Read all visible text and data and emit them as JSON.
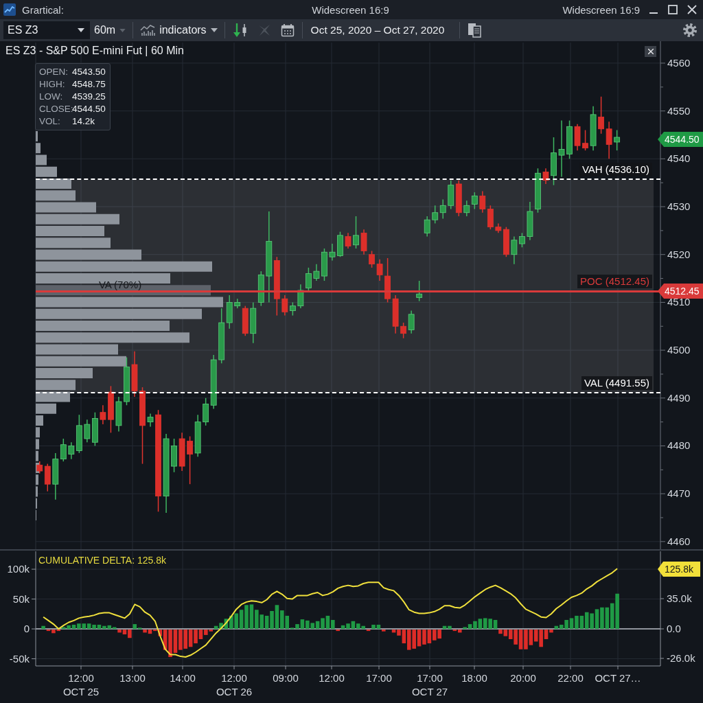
{
  "window": {
    "title": "Grartical:",
    "center_label": "Widescreen 16:9",
    "right_label": "Widescreen 16:9"
  },
  "toolbar": {
    "symbol": "ES Z3",
    "interval": "60m",
    "indicators": "indicators",
    "date_range": "Oct 25, 2020 – Oct 27, 2020"
  },
  "chart": {
    "title": "ES Z3 - S&P 500 E-mini Fut | 60 Min",
    "ohlc": [
      {
        "label": "OPEN:",
        "value": "4543.50"
      },
      {
        "label": "HIGH:",
        "value": "4548.75"
      },
      {
        "label": "LOW:",
        "value": "4539.25"
      },
      {
        "label": "CLOSE:",
        "value": "4544.50"
      },
      {
        "label": "VOL:",
        "value": "14.2k"
      }
    ],
    "value_area_label": "VA (70%)",
    "levels": [
      {
        "kind": "dashed",
        "label": "VAH (4536.10)",
        "color": "#ffffff"
      },
      {
        "kind": "solid",
        "label": "POC (4512.45)",
        "color": "#d93a3a"
      },
      {
        "kind": "dashed",
        "label": "VAL (4491.55)",
        "color": "#ffffff"
      }
    ],
    "price_markers": [
      {
        "value": "4544.50",
        "color": "#1f9a45"
      },
      {
        "value": "4512.45",
        "color": "#d93a3a"
      }
    ],
    "chart_data": {
      "type": "candlestick",
      "categories": [
        null,
        null,
        null,
        null,
        null,
        null,
        null,
        null,
        null,
        null,
        null,
        null,
        null,
        null,
        null,
        null,
        null,
        null,
        null,
        null,
        null,
        null,
        null,
        null,
        null,
        null,
        null,
        null,
        null,
        null,
        null,
        null,
        null,
        null,
        null,
        null,
        null,
        null,
        null,
        null,
        null,
        null,
        null,
        null,
        null,
        null,
        null,
        null,
        null,
        null,
        null,
        null,
        null,
        null,
        null,
        null,
        null,
        null,
        null,
        null,
        null,
        null,
        null,
        null,
        null,
        null,
        null,
        null,
        null,
        null,
        null,
        null,
        null,
        null,
        null,
        null,
        null,
        null,
        null
      ],
      "ylim": [
        4458.4,
        4564.3
      ],
      "yticks": [
        4560,
        4550,
        4540,
        4530,
        4520,
        4510,
        4500,
        4490,
        4480,
        4470,
        4460
      ],
      "grid": true,
      "ohlc": [
        [
          4476,
          4476.75,
          4474.25,
          4474.75
        ],
        [
          4475.75,
          4476.25,
          4470.5,
          4472
        ],
        [
          4472,
          4478.5,
          4468.75,
          4477.25
        ],
        [
          4477.25,
          4481.5,
          4476.75,
          4480.25
        ],
        [
          4478.25,
          4480.75,
          4477.25,
          4480
        ],
        [
          4479,
          4486.5,
          4478.5,
          4484.25
        ],
        [
          4481.5,
          4485.5,
          4480.75,
          4484.5
        ],
        [
          4480.75,
          4487,
          4480,
          4485.75
        ],
        [
          4487,
          4488.5,
          4484.5,
          4485.5
        ],
        [
          4491.25,
          4492.5,
          4482.75,
          4485.5
        ],
        [
          4484.25,
          4490.25,
          4483,
          4489.25
        ],
        [
          4489.25,
          4498.5,
          4488.5,
          4496.5
        ],
        [
          4497,
          4499.75,
          4490.25,
          4491.5
        ],
        [
          4491.5,
          4492.25,
          4476.25,
          4484.25
        ],
        [
          4485,
          4486.75,
          4484,
          4486
        ],
        [
          4486.5,
          4487.5,
          4466.25,
          4469.5
        ],
        [
          4469.5,
          4482.5,
          4466,
          4481.5
        ],
        [
          4475.75,
          4481.5,
          4474.5,
          4480
        ],
        [
          4481.5,
          4482.75,
          4474.75,
          4475.75
        ],
        [
          4481,
          4482,
          4472,
          4478.25
        ],
        [
          4478.5,
          4486.5,
          4477.75,
          4485
        ],
        [
          4485,
          4490,
          4484.25,
          4488.75
        ],
        [
          4488.5,
          4499,
          4487.75,
          4498
        ],
        [
          4498,
          4508.75,
          4497.25,
          4505.75
        ],
        [
          4505.75,
          4511.5,
          4504.5,
          4510
        ],
        [
          4509.25,
          4510.75,
          4508.75,
          4510
        ],
        [
          4508.75,
          4509.25,
          4503,
          4503.5
        ],
        [
          4503.5,
          4510,
          4501.5,
          4508.75
        ],
        [
          4510,
          4516.5,
          4509.25,
          4515.75
        ],
        [
          4515.5,
          4529,
          4510,
          4522.75
        ],
        [
          4518.75,
          4519.5,
          4507.25,
          4510.75
        ],
        [
          4510.75,
          4511.5,
          4507.25,
          4508
        ],
        [
          4508.25,
          4510,
          4507.25,
          4509.25
        ],
        [
          4509.25,
          4513.75,
          4508.75,
          4512.5
        ],
        [
          4513,
          4517.25,
          4512.25,
          4516
        ],
        [
          4515,
          4518,
          4514.5,
          4516.5
        ],
        [
          4515.5,
          4521.25,
          4514.5,
          4520.5
        ],
        [
          4519.5,
          4522.25,
          4518.75,
          4520.5
        ],
        [
          4519.75,
          4524.75,
          4519.5,
          4524
        ],
        [
          4523.75,
          4524.5,
          4521.25,
          4521.75
        ],
        [
          4522,
          4528,
          4521.25,
          4524
        ],
        [
          4524.5,
          4525.25,
          4520,
          4520.75
        ],
        [
          4520,
          4520.75,
          4517.25,
          4518
        ],
        [
          4518,
          4519,
          4514.5,
          4515.75
        ],
        [
          4515.5,
          4519.25,
          4510,
          4510.75
        ],
        [
          4510.75,
          4511.5,
          4503.5,
          4505
        ],
        [
          4505,
          4505.75,
          4502.5,
          4503.5
        ],
        [
          4504.25,
          4508.25,
          4503.5,
          4507.5
        ],
        [
          4511,
          4514.5,
          4510.25,
          4511.75
        ],
        [
          4524.5,
          4528,
          4523.75,
          4527.25
        ],
        [
          4527.25,
          4530.25,
          4526.5,
          4528.75
        ],
        [
          4528.75,
          4531.5,
          4527.5,
          4530.25
        ],
        [
          4530.25,
          4535.5,
          4529.5,
          4534.5
        ],
        [
          4534.75,
          4535.5,
          4528,
          4528.75
        ],
        [
          4528.75,
          4531.25,
          4528,
          4530.25
        ],
        [
          4530.5,
          4533,
          4529.5,
          4532.25
        ],
        [
          4532.25,
          4533.25,
          4528.75,
          4529.5
        ],
        [
          4529.5,
          4530.25,
          4525.25,
          4525.75
        ],
        [
          4525.75,
          4526.5,
          4524.5,
          4525
        ],
        [
          4525.25,
          4525.75,
          4519.5,
          4520
        ],
        [
          4520,
          4523.75,
          4518,
          4523
        ],
        [
          4522.25,
          4524.5,
          4521.5,
          4523.75
        ],
        [
          4523.75,
          4531,
          4523,
          4529
        ],
        [
          4529.5,
          4538,
          4528.75,
          4537
        ],
        [
          4537.25,
          4538,
          4534.75,
          4535.5
        ],
        [
          4536.5,
          4544.5,
          4534.5,
          4541.25
        ],
        [
          4540.75,
          4548,
          4536.25,
          4542
        ],
        [
          4541,
          4548,
          4540,
          4546.75
        ],
        [
          4546.75,
          4547.25,
          4541.75,
          4542.75
        ],
        [
          4543.25,
          4546,
          4541.75,
          4542.25
        ],
        [
          4542.75,
          4551,
          4541.75,
          4549.25
        ],
        [
          4548.75,
          4553,
          4545.25,
          4546.25
        ],
        [
          4546.25,
          4547.75,
          4540,
          4543
        ],
        [
          4543.5,
          4546,
          4541.75,
          4544.5
        ],
        null,
        null,
        null,
        null,
        null
      ]
    }
  },
  "delta": {
    "chart_data": {
      "type": "line",
      "title": "CUMULATIVE DELTA: 125.8k",
      "categories": [
        null,
        null,
        null,
        null,
        null,
        null,
        null,
        null,
        null,
        null,
        null,
        null,
        null,
        null,
        null,
        null,
        null,
        null,
        null,
        null,
        null,
        null,
        null,
        null,
        null,
        null,
        null,
        null,
        null,
        null,
        null,
        null,
        null,
        null,
        null,
        null,
        null,
        null,
        null,
        null,
        null,
        null,
        null,
        null,
        null,
        null,
        null,
        null,
        null,
        null,
        null,
        null,
        null,
        null,
        null,
        null,
        null,
        null,
        null,
        null,
        null,
        null,
        null,
        null,
        null,
        null,
        null,
        null,
        null,
        null,
        null,
        null,
        null,
        null,
        null,
        null,
        null,
        null,
        null,
        null,
        null,
        null,
        null,
        null,
        null,
        null,
        null,
        null,
        null,
        null,
        null,
        null,
        null,
        null,
        null,
        null,
        null,
        null,
        null,
        null,
        null,
        null,
        null,
        null,
        null,
        null,
        null,
        null,
        null,
        null,
        null,
        null,
        null,
        null,
        null,
        null,
        null,
        null,
        null,
        null,
        null,
        null,
        null
      ],
      "ylim": [
        -62,
        130
      ],
      "yticks": [
        {
          "value": 100,
          "label": "100k"
        },
        {
          "value": 50,
          "label": "50k"
        },
        {
          "value": 0,
          "label": "0"
        },
        {
          "value": -50,
          "label": "-50k"
        }
      ],
      "grid": true,
      "series": [
        {
          "color": "#f0e03c",
          "values": [
            null,
            20,
            14,
            8,
            0,
            6,
            11,
            14,
            18,
            20,
            21,
            23,
            26,
            27,
            27,
            24,
            21,
            18,
            25,
            41,
            37,
            28,
            23,
            13,
            -12,
            -34,
            -43,
            -43,
            -46,
            -47,
            -44,
            -39,
            -33,
            -27,
            -17,
            -7,
            1,
            10,
            21,
            33,
            41,
            45,
            47,
            46,
            44,
            49,
            58,
            63,
            58,
            51,
            50,
            56,
            56,
            56,
            59,
            61,
            56,
            58,
            62,
            68,
            71,
            73,
            71,
            72,
            76,
            78,
            78,
            78,
            69,
            66,
            64,
            56,
            45,
            32,
            28,
            26,
            26,
            27,
            29,
            33,
            39,
            39,
            36,
            35,
            40,
            47,
            54,
            60,
            66,
            70,
            73,
            69,
            64,
            59,
            52,
            42,
            33,
            29,
            25,
            20,
            19,
            25,
            34,
            40,
            47,
            53,
            56,
            60,
            67,
            72,
            79,
            84,
            89,
            94,
            101,
            null,
            null,
            null,
            null,
            null,
            null,
            null,
            null
          ]
        }
      ]
    },
    "right_axis": [
      {
        "kind": "marker",
        "label": "125.8k"
      },
      {
        "kind": "tick",
        "label": "35.0k"
      },
      {
        "kind": "tick",
        "label": "0.0"
      },
      {
        "kind": "tick",
        "label": "-26.0k"
      }
    ],
    "time_axis": [
      {
        "time": "12:00",
        "date": "OCT 25"
      },
      {
        "time": "13:00"
      },
      {
        "time": "14:00"
      },
      {
        "time": "12:00",
        "date": "OCT 26"
      },
      {
        "time": "09:00"
      },
      {
        "time": "12:00"
      },
      {
        "time": "17:00"
      },
      {
        "time": "17:00",
        "date": "OCT 27"
      },
      {
        "time": "18:00"
      },
      {
        "time": "20:00"
      },
      {
        "time": "22:00"
      },
      {
        "time": "OCT 27…"
      }
    ]
  }
}
